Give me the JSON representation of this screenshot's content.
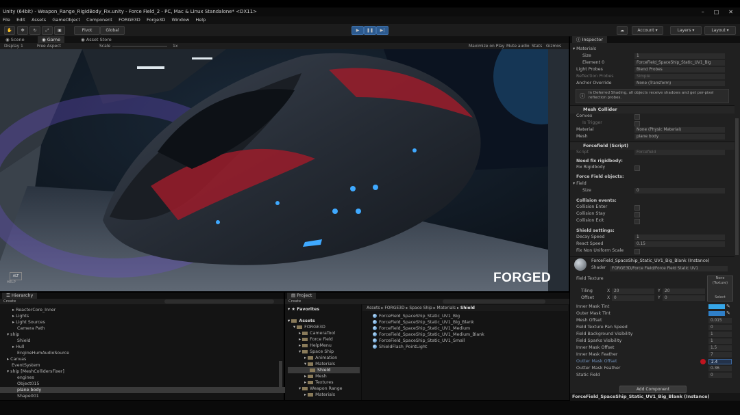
{
  "window": {
    "title": "Unity (64bit) - Weapon_Range_RigidBody_Fix.unity - Force Field_2 - PC, Mac & Linux Standalone* <DX11>",
    "controls": [
      "–",
      "□",
      "✕"
    ]
  },
  "menu": [
    "File",
    "Edit",
    "Assets",
    "GameObject",
    "Component",
    "FORGE3D",
    "Forge3D",
    "Window",
    "Help"
  ],
  "toolbar": {
    "pivot": "Pivot",
    "global": "Global",
    "account": "Account",
    "layers": "Layers",
    "layout": "Layout"
  },
  "tabs": [
    "Scene",
    "Game",
    "Asset Store"
  ],
  "gamebar": {
    "display": "Display 1",
    "aspect": "Free Aspect",
    "scale_label": "Scale",
    "scale_value": "1x",
    "maximize": "Maximize on Play",
    "mute": "Mute audio",
    "stats": "Stats",
    "gizmos": "Gizmos"
  },
  "gameview": {
    "logo": "FORGED",
    "hud_top": "ALT",
    "hud_bottom": "HELP"
  },
  "hierarchy": {
    "title": "Hierarchy",
    "create": "Create",
    "rows": [
      "ReactorCore_Inner",
      "Lights",
      "Light Sources",
      "Camera Path",
      "ship",
      "Shield",
      "Hull",
      "EngineHumAudioSource",
      "Canvas",
      "EventSystem",
      "ship [MeshCollidersFixer]",
      "engines",
      "Object015",
      "plane body",
      "Shape001"
    ]
  },
  "project": {
    "title": "Project",
    "create": "Create",
    "favorites": "Favorites",
    "assets": "Assets",
    "tree": [
      "FORGE3D",
      "CameraTool",
      "Force Field",
      "HelpMenu",
      "Space Ship",
      "Animation",
      "Materials",
      "Shield",
      "Mesh",
      "Textures",
      "Weapon Range",
      "Materials"
    ],
    "breadcrumb": [
      "Assets",
      "FORGE3D",
      "Space Ship",
      "Materials",
      "Shield"
    ],
    "files": [
      "ForceField_SpaceShip_Static_UV1_Big",
      "ForceField_SpaceShip_Static_UV1_Big_Blank",
      "ForceField_SpaceShip_Static_UV1_Medium",
      "ForceField_SpaceShip_Static_UV1_Medium_Blank",
      "ForceField_SpaceShip_Static_UV1_Small",
      "ShieldFlash_PointLight"
    ]
  },
  "inspector": {
    "title": "Inspector",
    "materials": "Materials",
    "size_label": "Size",
    "size_value": "1",
    "element0_label": "Element 0",
    "element0_value": "ForceField_SpaceShip_Static_UV1_Big",
    "light_probes_label": "Light Probes",
    "light_probes_value": "Blend Probes",
    "reflection_label": "Reflection Probes",
    "reflection_value": "Simple",
    "anchor_label": "Anchor Override",
    "anchor_value": "None (Transform)",
    "info": "In Deferred Shading, all objects receive shadows and get per-pixel reflection probes.",
    "mesh_collider": "Mesh Collider",
    "convex": "Convex",
    "is_trigger": "Is Trigger",
    "material_label": "Material",
    "material_value": "None (Physic Material)",
    "mesh_label": "Mesh",
    "mesh_value": "plane body",
    "forcefield": "Forcefield (Script)",
    "script_label": "Script",
    "script_value": "Forcefield",
    "need_fix": "Need fix rigidbody:",
    "fix_rigidbody": "Fix Rigidbody",
    "ff_objects": "Force Field objects:",
    "field": "Field",
    "field_size_label": "Size",
    "field_size_value": "0",
    "collision_events": "Collision events:",
    "collision_enter": "Collision Enter",
    "collision_stay": "Collision Stay",
    "collision_exit": "Collision Exit",
    "shield_settings": "Shield settings:",
    "decay_label": "Decay Speed",
    "decay_value": "1",
    "react_label": "React Speed",
    "react_value": "0.15",
    "nonuniform": "Fix Non Uniform Scale",
    "material_name": "ForceField_SpaceShip_Static_UV1_Big_Blank (Instance)",
    "shader_label": "Shader",
    "shader_value": "FORGE3D/Force Field/Force Field Static UV1",
    "field_texture": "Field Texture",
    "none_texture": "None (Texture)",
    "select": "Select",
    "tiling": "Tiling",
    "offset": "Offset",
    "tiling_x": "20",
    "tiling_y": "20",
    "offset_x": "0",
    "offset_y": "0",
    "props": [
      {
        "label": "Inner Mask Tint",
        "value": ""
      },
      {
        "label": "Outer Mask Tint",
        "value": ""
      },
      {
        "label": "Mesh Offset",
        "value": "0.015"
      },
      {
        "label": "Field Texture Pan Speed",
        "value": "0"
      },
      {
        "label": "Field Background Visibility",
        "value": "1"
      },
      {
        "label": "Field Sparks Visibility",
        "value": "1"
      },
      {
        "label": "Inner Mask Offset",
        "value": "1.5"
      },
      {
        "label": "Inner Mask Feather",
        "value": "7"
      },
      {
        "label": "Outter Mask Offset",
        "value": "2.4"
      },
      {
        "label": "Outter Mask Feather",
        "value": "0.36"
      },
      {
        "label": "Static Field",
        "value": "0"
      }
    ],
    "add_component": "Add Component",
    "footer": "ForceField_SpaceShip_Static_UV1_Big_Blank (Instance)"
  },
  "colors": {
    "accent_blue": "#2c5a8f",
    "engine_glow": "#3fa9ff",
    "hull_red": "#9b1c2a"
  }
}
